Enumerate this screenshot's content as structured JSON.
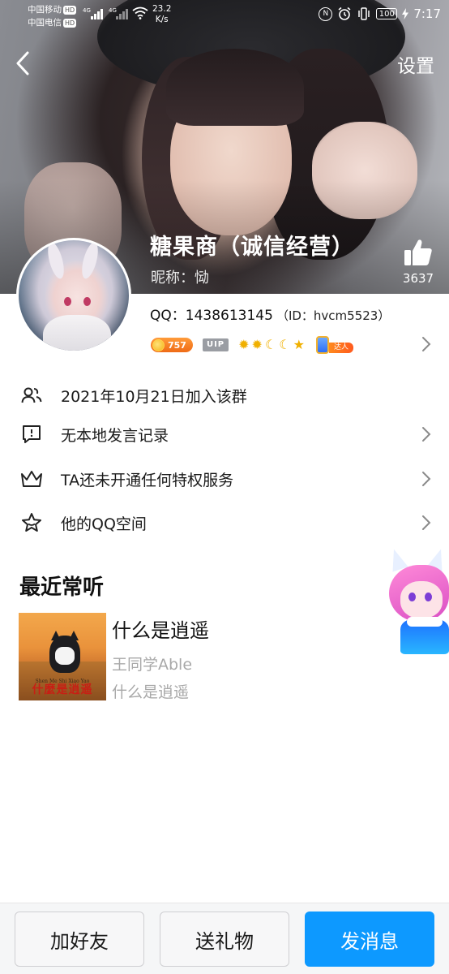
{
  "status_bar": {
    "carrier1": "中国移动",
    "carrier2": "中国电信",
    "hd_tag": "HD",
    "net_tag1": "4G",
    "net_tag2": "4G",
    "speed_value": "23.2",
    "speed_unit": "K/s",
    "nfc": "N",
    "battery": "100",
    "time": "7:17"
  },
  "header": {
    "settings_label": "设置",
    "display_name": "糖果商（诚信经营）",
    "nickname_line": "昵称：恸",
    "like_count": "3637"
  },
  "profile": {
    "qq_label": "QQ：",
    "qq_number": "1438613145",
    "id_text": "（ID：hvcm5523）",
    "level_number": "757",
    "vip_label": "UIP",
    "daren_label": "达人"
  },
  "info_rows": [
    {
      "label": "2021年10月21日加入该群",
      "icon": "group-members-icon"
    },
    {
      "label": "无本地发言记录",
      "icon": "message-icon"
    },
    {
      "label": "TA还未开通任何特权服务",
      "icon": "crown-icon"
    },
    {
      "label": "他的QQ空间",
      "icon": "star-icon"
    }
  ],
  "recent": {
    "title": "最近常听",
    "song_name": "什么是逍遥",
    "artist": "王同学Able",
    "album": "什么是逍遥",
    "cover_pinyin": "Shen Me Shi Xiao Yao",
    "cover_title": "什麼是逍遥"
  },
  "actions": {
    "add_friend": "加好友",
    "send_gift": "送礼物",
    "send_message": "发消息"
  },
  "colors": {
    "primary": "#0d99ff",
    "level_badge": "#ef6b16",
    "secondary_text": "#a8a8a8"
  }
}
